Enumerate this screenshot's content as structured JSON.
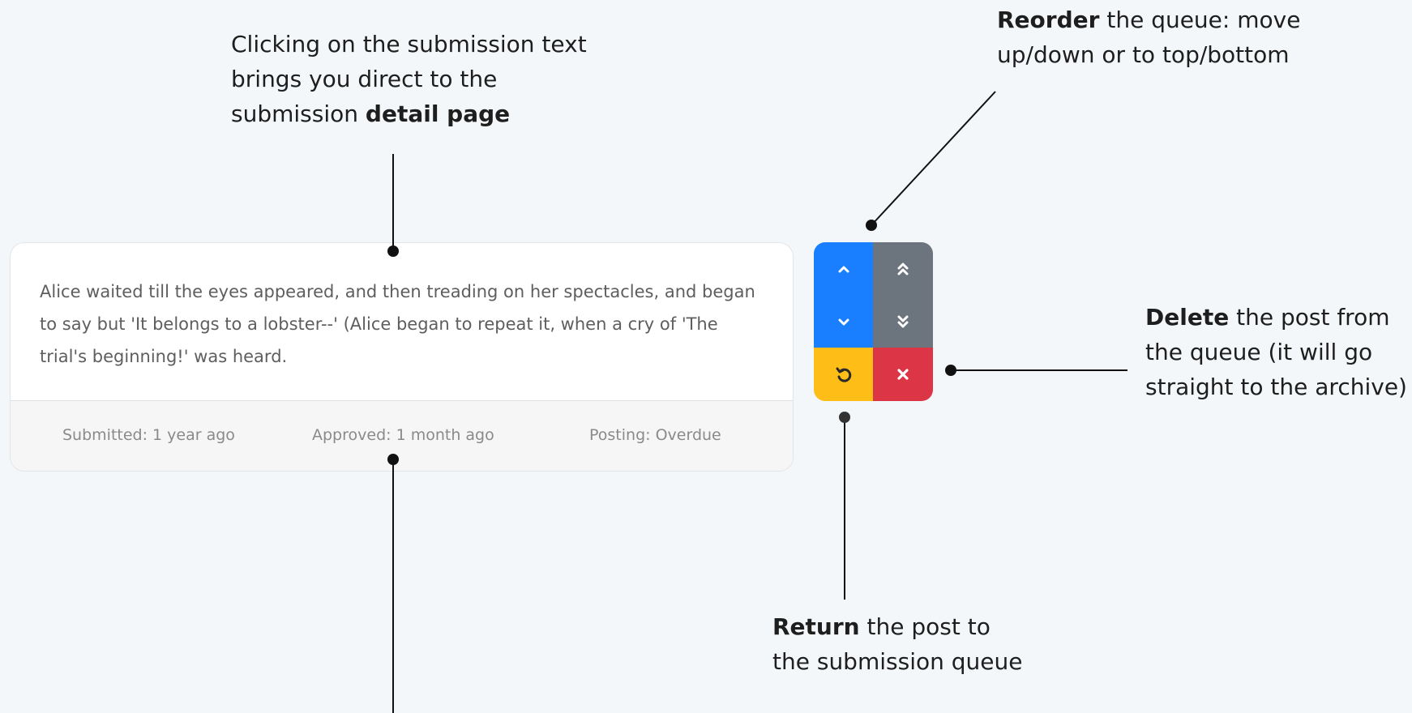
{
  "notes": {
    "detail": {
      "pre": "Clicking on the submission text brings you direct to the submission ",
      "bold": "detail page",
      "post": ""
    },
    "reorder": {
      "bold": "Reorder",
      "post": " the queue: move up/down or to top/bottom"
    },
    "delete": {
      "bold": "Delete",
      "post": " the post from the queue (it will go straight to the archive)"
    },
    "return": {
      "bold": "Return",
      "post": " the post to the submission queue"
    }
  },
  "card": {
    "text": "Alice waited till the eyes appeared, and then treading on her spectacles, and began to say but 'It belongs to a lobster--' (Alice began to repeat it, when a cry of 'The trial's beginning!' was heard.",
    "submitted": "Submitted: 1 year ago",
    "approved": "Approved: 1 month ago",
    "posting": "Posting: Overdue"
  },
  "buttons": {
    "up": "chevron-up-icon",
    "top": "double-chevron-up-icon",
    "down": "chevron-down-icon",
    "bottom": "double-chevron-down-icon",
    "return": "undo-icon",
    "delete": "close-icon"
  },
  "colors": {
    "move": "#1a7fff",
    "move_end": "#6c757d",
    "return": "#ffbd17",
    "delete": "#dc3545",
    "background": "#f4f7f9"
  }
}
